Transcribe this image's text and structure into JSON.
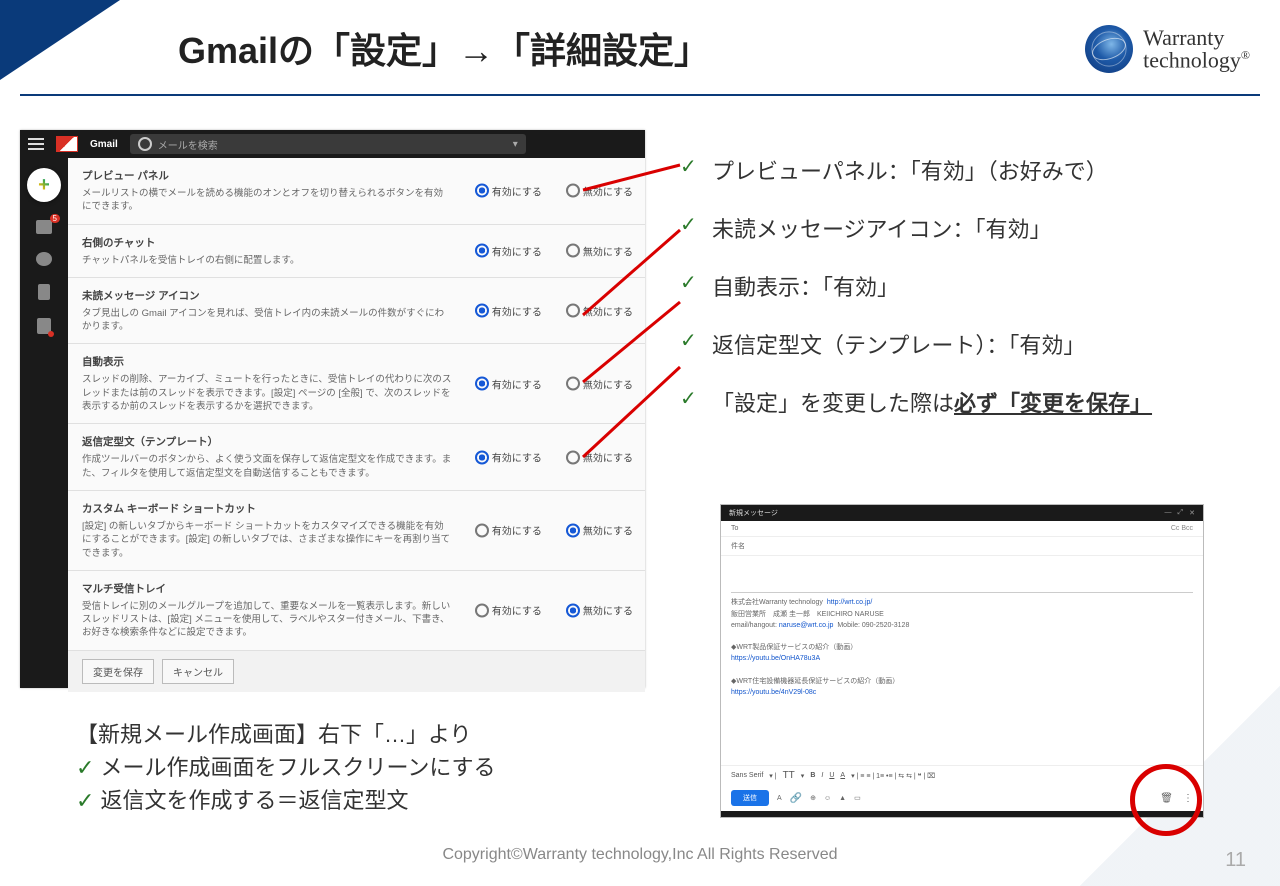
{
  "title": "Gmailの「設定」→「詳細設定」",
  "brand": {
    "line1": "Warranty",
    "line2": "technology"
  },
  "gmail": {
    "product": "Gmail",
    "search_placeholder": "メールを検索",
    "enable_label": "有効にする",
    "disable_label": "無効にする",
    "settings": [
      {
        "title": "プレビュー パネル",
        "desc": "メールリストの横でメールを読める機能のオンとオフを切り替えられるボタンを有効にできます。",
        "selected": "enable"
      },
      {
        "title": "右側のチャット",
        "desc": "チャットパネルを受信トレイの右側に配置します。",
        "selected": "enable"
      },
      {
        "title": "未読メッセージ アイコン",
        "desc": "タブ見出しの Gmail アイコンを見れば、受信トレイ内の未読メールの件数がすぐにわかります。",
        "selected": "enable"
      },
      {
        "title": "自動表示",
        "desc": "スレッドの削除、アーカイブ、ミュートを行ったときに、受信トレイの代わりに次のスレッドまたは前のスレッドを表示できます。[設定] ページの [全般] で、次のスレッドを表示するか前のスレッドを表示するかを選択できます。",
        "selected": "enable"
      },
      {
        "title": "返信定型文（テンプレート）",
        "desc": "作成ツールバーのボタンから、よく使う文面を保存して返信定型文を作成できます。また、フィルタを使用して返信定型文を自動送信することもできます。",
        "selected": "enable"
      },
      {
        "title": "カスタム キーボード ショートカット",
        "desc": "[設定] の新しいタブからキーボード ショートカットをカスタマイズできる機能を有効にすることができます。[設定] の新しいタブでは、さまざまな操作にキーを再割り当てできます。",
        "selected": "disable"
      },
      {
        "title": "マルチ受信トレイ",
        "desc": "受信トレイに別のメールグループを追加して、重要なメールを一覧表示します。新しいスレッドリストは、[設定] メニューを使用して、ラベルやスター付きメール、下書き、お好きな検索条件などに設定できます。",
        "selected": "disable"
      }
    ],
    "save_btn": "変更を保存",
    "cancel_btn": "キャンセル"
  },
  "checklist": [
    "プレビューパネル：「有効」（お好みで）",
    "未読メッセージアイコン：「有効」",
    "自動表示：「有効」",
    "返信定型文（テンプレート）：「有効」"
  ],
  "checklist_last_prefix": "「設定」を変更した際は",
  "checklist_last_bold": "必ず「変更を保存」",
  "compose": {
    "header": "新規メッセージ",
    "to_label": "To",
    "ccbcc": "Cc Bcc",
    "subject": "件名",
    "sig_company": "株式会社Warranty technology",
    "sig_url": "http://wrt.co.jp/",
    "sig_name": "飯田営業所　成瀬 圭一郎　KEIICHIRO NARUSE",
    "sig_email_label": "email/hangout:",
    "sig_email": "naruse@wrt.co.jp",
    "sig_mobile": "Mobile: 090-2520-3128",
    "sig_line1": "◆WRT製品保証サービスの紹介（動画）",
    "sig_link1": "https://youtu.be/OnHA78u3A",
    "sig_line2": "◆WRT住宅設備機器延長保証サービスの紹介（動画）",
    "sig_link2": "https://youtu.be/4nV29l-08c",
    "font_label": "Sans Serif",
    "send_label": "送信"
  },
  "bottom_notes": {
    "head": "【新規メール作成画面】右下「…」より",
    "items": [
      "メール作成画面をフルスクリーンにする",
      "返信文を作成する＝返信定型文"
    ]
  },
  "copyright": "Copyright©Warranty technology,Inc All Rights Reserved",
  "page_number": "11"
}
